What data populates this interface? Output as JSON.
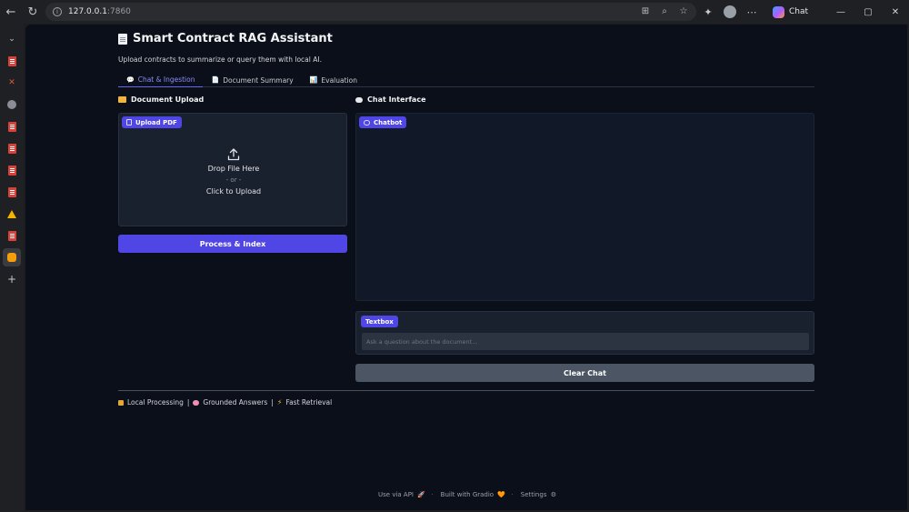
{
  "browser": {
    "url_host": "127.0.0.1",
    "url_port": ":7860",
    "copilot_label": "Chat"
  },
  "app": {
    "title": "Smart Contract RAG Assistant",
    "subtitle": "Upload contracts to summarize or query them with local AI.",
    "tabs": [
      {
        "icon": "💬",
        "label": "Chat & Ingestion",
        "active": true
      },
      {
        "icon": "📄",
        "label": "Document Summary",
        "active": false
      },
      {
        "icon": "📊",
        "label": "Evaluation",
        "active": false
      }
    ],
    "upload_section": {
      "heading": "Document Upload",
      "badge": "Upload PDF",
      "drop_text": "Drop File Here",
      "or_text": "- or -",
      "click_text": "Click to Upload",
      "process_button": "Process & Index"
    },
    "chat_section": {
      "heading": "Chat Interface",
      "chatbot_badge": "Chatbot",
      "textbox_badge": "Textbox",
      "textbox_placeholder": "Ask a question about the document...",
      "clear_button": "Clear Chat"
    },
    "footer_features": {
      "local": "Local Processing",
      "grounded": "Grounded Answers",
      "fast": "Fast Retrieval",
      "sep": "|"
    },
    "gradio_footer": {
      "api": "Use via API",
      "built": "Built with Gradio",
      "settings": "Settings",
      "dot": "·"
    }
  },
  "colors": {
    "accent": "#4f46e5",
    "app_bg": "#0b0f19",
    "panel_bg": "#1a212e",
    "secondary_button": "#4b5563"
  }
}
